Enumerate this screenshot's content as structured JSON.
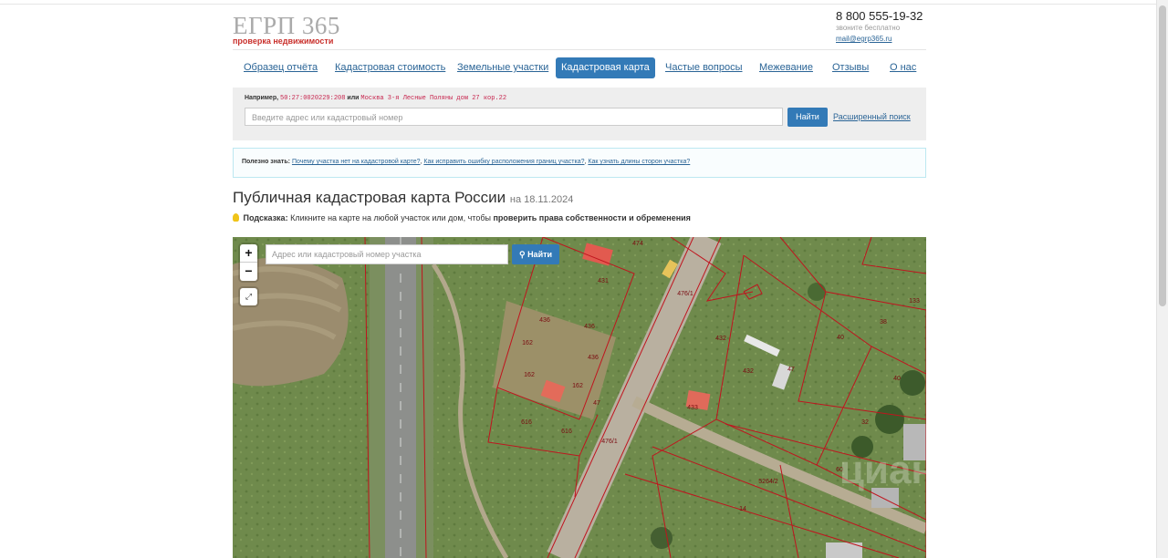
{
  "header": {
    "logo_name": "ЕГРП 365",
    "logo_tagline": "проверка недвижимости",
    "phone": "8 800 555-19-32",
    "phone_note": "звоните бесплатно",
    "email": "mail@egrp365.ru"
  },
  "nav": {
    "items": [
      {
        "label": "Образец отчёта"
      },
      {
        "label": "Кадастровая стоимость"
      },
      {
        "label": "Земельные участки"
      },
      {
        "label": "Кадастровая карта",
        "active": true
      },
      {
        "label": "Частые вопросы"
      },
      {
        "label": "Межевание"
      },
      {
        "label": "Отзывы"
      },
      {
        "label": "О нас"
      }
    ]
  },
  "search": {
    "example_prefix": "Например,",
    "example_code": "50:27:0020229:208",
    "example_or": "или",
    "example_address": "Москва 3-я Лесные Поляны дом 27 кор.22",
    "placeholder": "Введите адрес или кадастровый номер",
    "button": "Найти",
    "advanced": "Расширенный поиск"
  },
  "useful": {
    "label": "Полезно знать:",
    "links": [
      "Почему участка нет на кадастровой карте?",
      "Как исправить ошибку расположения границ участка?",
      "Как узнать длины сторон участка?"
    ]
  },
  "page": {
    "title": "Публичная кадастровая карта России",
    "date": "на 18.11.2024",
    "hint_label": "Подсказка:",
    "hint_text": "Кликните на карте на любой участок или дом, чтобы",
    "hint_bold": "проверить права собственности и обременения"
  },
  "map": {
    "zoom_in": "+",
    "zoom_out": "−",
    "search_placeholder": "Адрес или кадастровый номер участка",
    "search_button": "Найти",
    "watermark": "циан",
    "parcel_labels": [
      "474",
      "431",
      "436",
      "436",
      "436",
      "162",
      "162",
      "162",
      "616",
      "616",
      "47",
      "476/1",
      "476/1",
      "432",
      "432",
      "433",
      "38",
      "40",
      "40",
      "133",
      "32",
      "60",
      "14",
      "5264/2",
      "47",
      "40"
    ]
  },
  "colors": {
    "accent": "#337ab7",
    "link": "#2a6496",
    "brand_red": "#c9302c",
    "parcel_border": "#c0141e"
  }
}
